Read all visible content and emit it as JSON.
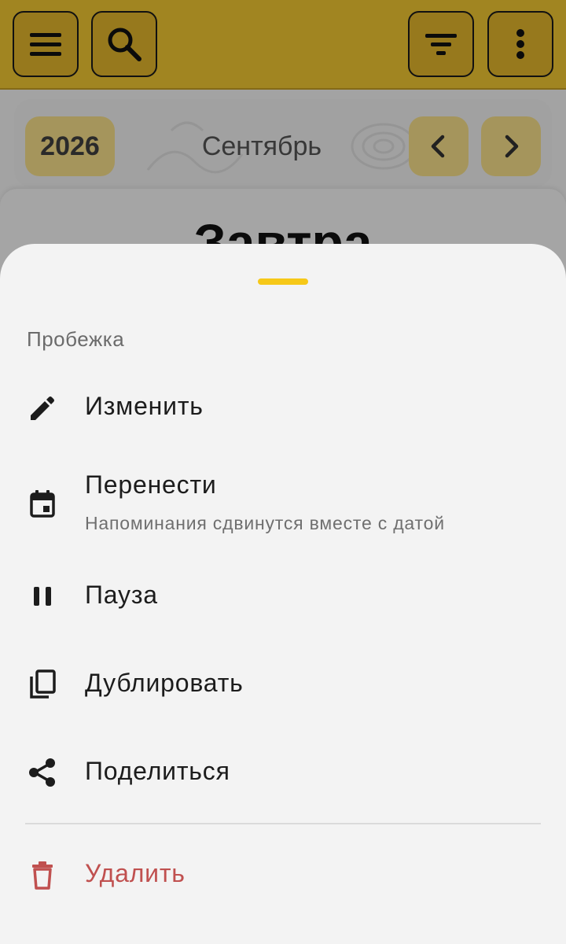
{
  "topbar": {
    "menu_icon": "menu-icon",
    "search_icon": "search-icon",
    "filter_icon": "filter-icon",
    "more_icon": "more-vert-icon",
    "accent": "#f5ca33"
  },
  "calendar": {
    "year": "2026",
    "month": "Сентябрь",
    "prev_icon": "chevron-left-icon",
    "next_icon": "chevron-right-icon"
  },
  "day": {
    "title": "Завтра"
  },
  "sheet": {
    "title": "Пробежка",
    "handle_color": "#f6c818",
    "items": [
      {
        "label": "Изменить",
        "icon": "edit-icon"
      },
      {
        "label": "Перенести",
        "subtitle": "Напоминания сдвинутся вместе с датой",
        "icon": "calendar-icon"
      },
      {
        "label": "Пауза",
        "icon": "pause-icon"
      },
      {
        "label": "Дублировать",
        "icon": "copy-icon"
      },
      {
        "label": "Поделиться",
        "icon": "share-icon"
      }
    ],
    "danger_item": {
      "label": "Удалить",
      "icon": "delete-icon",
      "color": "#c0504f"
    }
  }
}
